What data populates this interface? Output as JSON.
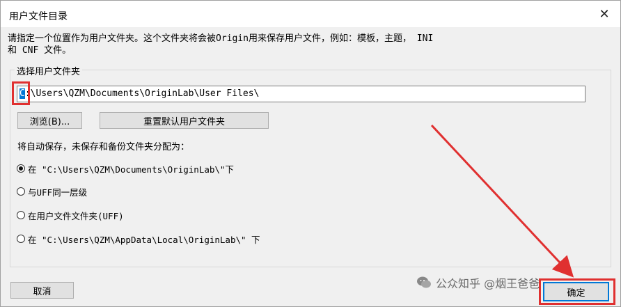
{
  "window": {
    "title": "用户文件目录",
    "close_glyph": "✕"
  },
  "description": "请指定一个位置作为用户文件夹。这个文件夹将会被Origin用来保存用户文件，例如：模板，主题， INI 和 CNF 文件。",
  "group": {
    "legend": "选择用户文件夹",
    "path_first_char": "C",
    "path_rest": ":\\Users\\QZM\\Documents\\OriginLab\\User Files\\",
    "browse_label": "浏览(B)...",
    "reset_label": "重置默认用户文件夹",
    "autosave_label": "将自动保存，未保存和备份文件夹分配为：",
    "options": [
      {
        "label": "在 \"C:\\Users\\QZM\\Documents\\OriginLab\\\"下",
        "checked": true
      },
      {
        "label": "与UFF同一层级",
        "checked": false
      },
      {
        "label": "在用户文件文件夹(UFF)",
        "checked": false
      },
      {
        "label": "在 \"C:\\Users\\QZM\\AppData\\Local\\OriginLab\\\" 下",
        "checked": false
      }
    ]
  },
  "footer": {
    "cancel_label": "取消",
    "ok_label": "确定"
  },
  "watermark": {
    "text": "公众知乎 @烟王爸爸",
    "icon": "wechat-icon"
  },
  "annotations": {
    "color": "#e03030"
  },
  "colors": {
    "selection": "#0078d7",
    "dialog_bg": "#f0f0f0",
    "button_bg": "#e1e1e1"
  }
}
